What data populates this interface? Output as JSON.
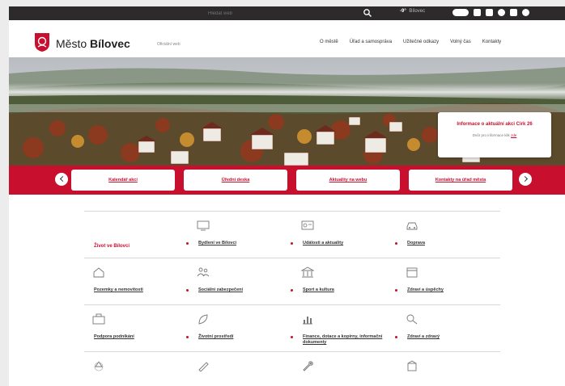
{
  "topbar": {
    "search_placeholder": "Hledat web",
    "weather": "-9°",
    "weather_sub": "Bílovec"
  },
  "header": {
    "logo_prefix": "Město",
    "logo_name": "Bílovec",
    "logo_sub": "Oficiální web",
    "nav": [
      "O městě",
      "Úřad a samospráva",
      "Užitečné odkazy",
      "Volný čas",
      "Kontakty"
    ]
  },
  "info_card": {
    "title": "Informace o aktuální akci Cirk 26",
    "text": "Dvůr pro informace klik",
    "link": "zde"
  },
  "quick_links": [
    "Kalendář akcí",
    "Úřední deska",
    "Aktuality na webu",
    "Kontakty na úřad města"
  ],
  "life": {
    "heading": "Život ve Bílovci",
    "items": [
      "Bydlení ve Bílovci",
      "Události a aktuality",
      "Doprava",
      "Pozemky a nemovitosti",
      "Sociální zabezpečení",
      "Sport a kultura",
      "Zdraví a úspěchy",
      "Podpora podnikání",
      "Životní prostředí",
      "Finance, dotace a kopírny, informační dokumenty",
      "Zdraví a zdravý",
      "",
      "",
      "",
      ""
    ]
  }
}
